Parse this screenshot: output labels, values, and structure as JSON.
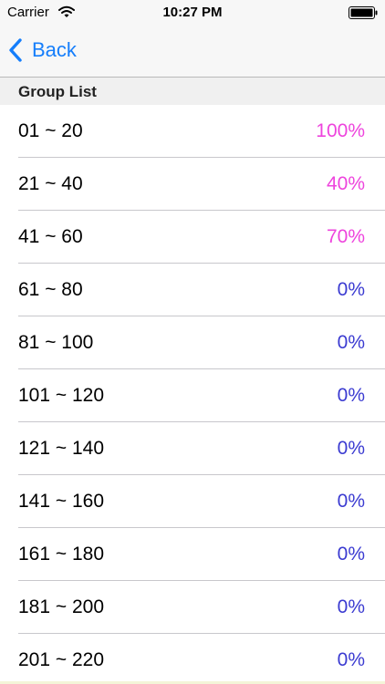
{
  "status_bar": {
    "carrier": "Carrier",
    "time": "10:27 PM",
    "wifi_icon": "wifi-icon",
    "battery_icon": "battery-icon"
  },
  "nav": {
    "back_icon": "chevron-left-icon",
    "back_label": "Back",
    "accent_color": "#157efb"
  },
  "section": {
    "title": "Group List"
  },
  "colors": {
    "progress": "#ee44dd",
    "zero": "#3b3bd1"
  },
  "groups": [
    {
      "range": "01 ~ 20",
      "percent": "100%",
      "status": "progress"
    },
    {
      "range": "21 ~ 40",
      "percent": "40%",
      "status": "progress"
    },
    {
      "range": "41 ~ 60",
      "percent": "70%",
      "status": "progress"
    },
    {
      "range": "61 ~ 80",
      "percent": "0%",
      "status": "zero"
    },
    {
      "range": "81 ~ 100",
      "percent": "0%",
      "status": "zero"
    },
    {
      "range": "101 ~ 120",
      "percent": "0%",
      "status": "zero"
    },
    {
      "range": "121 ~ 140",
      "percent": "0%",
      "status": "zero"
    },
    {
      "range": "141 ~ 160",
      "percent": "0%",
      "status": "zero"
    },
    {
      "range": "161 ~ 180",
      "percent": "0%",
      "status": "zero"
    },
    {
      "range": "181 ~ 200",
      "percent": "0%",
      "status": "zero"
    },
    {
      "range": "201 ~ 220",
      "percent": "0%",
      "status": "zero"
    }
  ]
}
